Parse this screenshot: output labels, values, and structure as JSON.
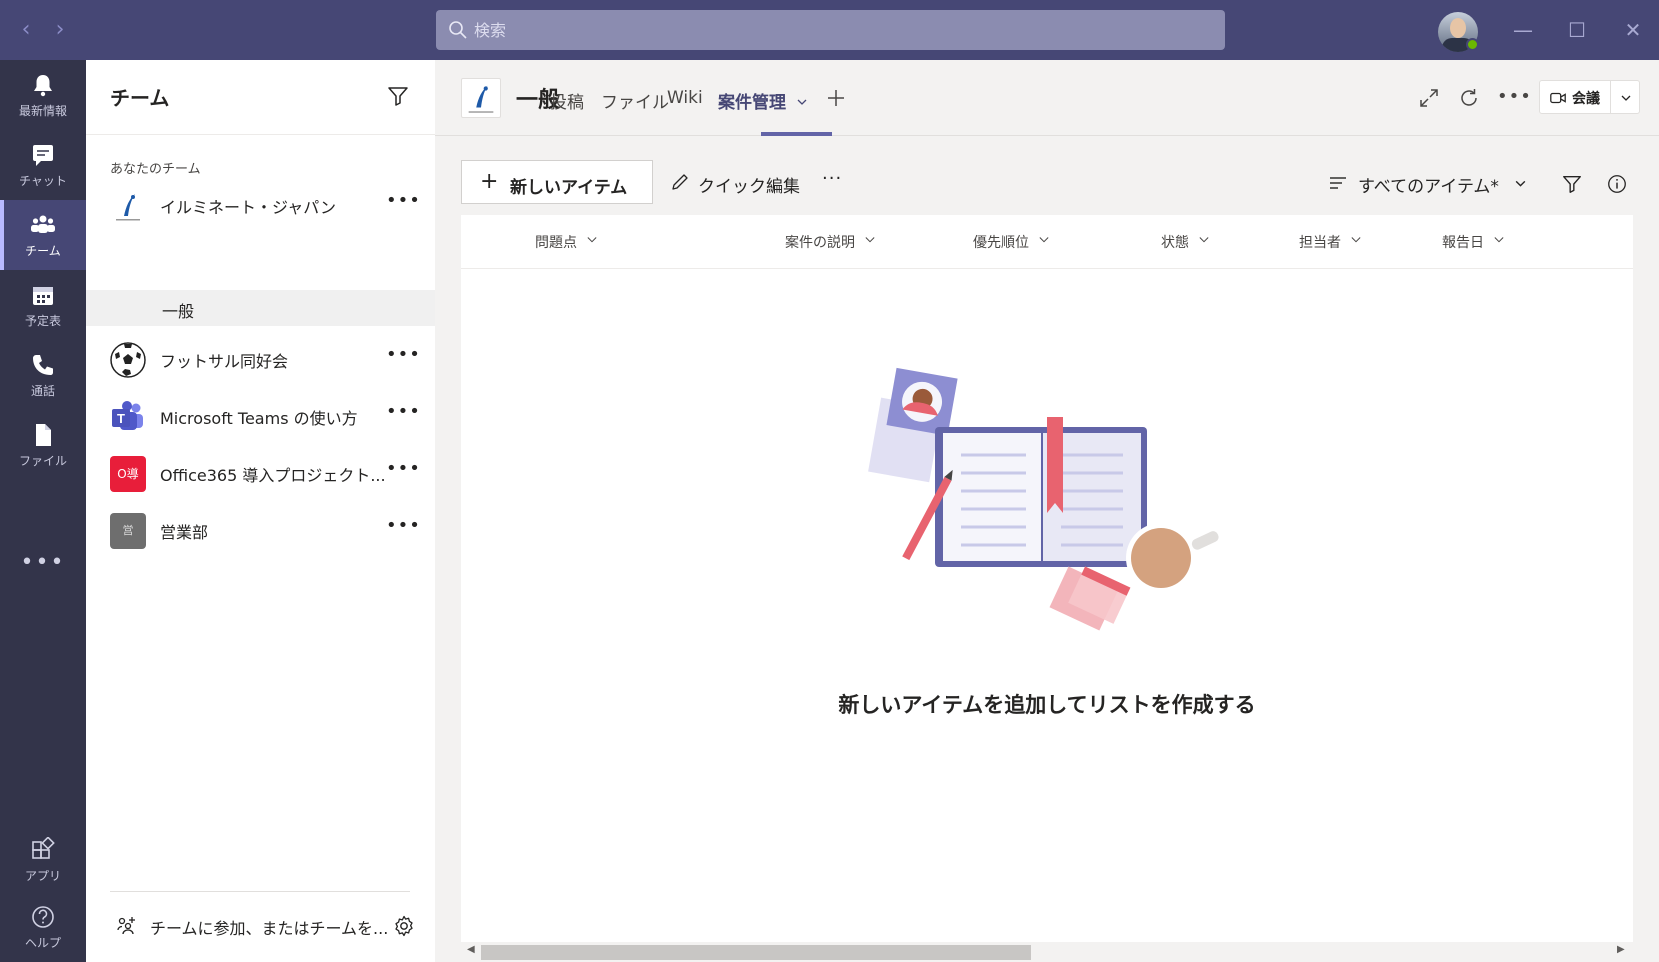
{
  "search": {
    "placeholder": "検索"
  },
  "rail": {
    "items": [
      {
        "label": "最新情報",
        "icon": "bell-icon"
      },
      {
        "label": "チャット",
        "icon": "chat-icon"
      },
      {
        "label": "チーム",
        "icon": "teams-icon",
        "active": true
      },
      {
        "label": "予定表",
        "icon": "calendar-icon"
      },
      {
        "label": "通話",
        "icon": "phone-icon"
      },
      {
        "label": "ファイル",
        "icon": "file-icon"
      }
    ],
    "more": "•••",
    "bottom": [
      {
        "label": "アプリ",
        "icon": "apps-icon"
      },
      {
        "label": "ヘルプ",
        "icon": "help-icon"
      }
    ]
  },
  "teams_panel": {
    "title": "チーム",
    "section_label": "あなたのチーム",
    "teams": [
      {
        "name": "イルミネート・ジャパン",
        "logo": "illuminate-logo"
      },
      {
        "name": "フットサル同好会",
        "logo": "soccer-ball-icon"
      },
      {
        "name": "Microsoft Teams の使い方",
        "logo": "teams-logo-icon"
      },
      {
        "name": "Office365 導入プロジェクト...",
        "logo": "red-square-logo",
        "logo_text": "O導"
      },
      {
        "name": "営業部",
        "logo": "gray-square-logo",
        "logo_text": "営"
      }
    ],
    "active_channel": "一般",
    "join_label": "チームに参加、またはチームを..."
  },
  "channel": {
    "name": "一般",
    "tabs": [
      "投稿",
      "ファイル",
      "Wiki",
      "案件管理"
    ],
    "active_tab": "案件管理",
    "meet_label": "会議"
  },
  "commandbar": {
    "new_item": "新しいアイテム",
    "quick_edit": "クイック編集",
    "more": "···",
    "view": "すべてのアイテム*"
  },
  "list": {
    "columns": [
      "問題点",
      "案件の説明",
      "優先順位",
      "状態",
      "担当者",
      "報告日"
    ],
    "empty_message": "新しいアイテムを追加してリストを作成する"
  },
  "colors": {
    "titlebar": "#464775",
    "rail": "#33344a",
    "accent": "#6264a7",
    "illustration_pink": "#e8636f"
  }
}
